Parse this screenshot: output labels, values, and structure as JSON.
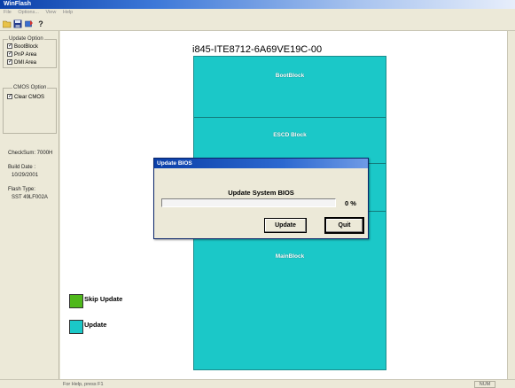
{
  "window": {
    "title": "WinFlash"
  },
  "menu": {
    "items": [
      "File",
      "Options...",
      "View",
      "Help"
    ]
  },
  "toolbar": {
    "icons": [
      "open-folder-icon",
      "save-disk-icon",
      "flash-icon",
      "help-icon"
    ]
  },
  "update_option": {
    "title": "Update Option",
    "items": [
      {
        "label": "BootBlock",
        "checked": true
      },
      {
        "label": "PnP Area",
        "checked": true
      },
      {
        "label": "DMI Area",
        "checked": true
      }
    ]
  },
  "cmos_option": {
    "title": "CMOS Option",
    "items": [
      {
        "label": "Clear CMOS",
        "checked": true
      }
    ]
  },
  "info": {
    "checksum": "CheckSum:  7000H",
    "build_date_label": "Build Date :",
    "build_date": "10/29/2001",
    "flash_type_label": "Flash Type:",
    "flash_type": "SST 49LF002A"
  },
  "chip": {
    "title": "i845-ITE8712-6A69VE19C-00",
    "blocks": [
      "BootBlock",
      "ESCD Block",
      "MainBlock"
    ],
    "color": "#1bc8c8"
  },
  "legend": [
    {
      "label": "Skip Update",
      "color": "#4fb81b"
    },
    {
      "label": "Update",
      "color": "#1bc8c8"
    }
  ],
  "dialog": {
    "title": "Update BIOS",
    "heading": "Update System BIOS",
    "progress_percent": 0,
    "progress_text": "0  %",
    "update_button": "Update",
    "quit_button": "Quit"
  },
  "status": {
    "text": "For Help, press F1",
    "num": "NUM"
  }
}
